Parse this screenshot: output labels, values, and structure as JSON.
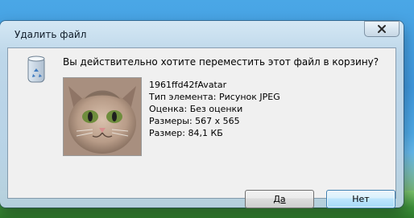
{
  "window": {
    "title": "Удалить файл"
  },
  "dialog": {
    "question": "Вы действительно хотите переместить этот файл в корзину?",
    "file": {
      "name": "1961ffd42fAvatar",
      "type": "Тип элемента: Рисунок JPEG",
      "rating": "Оценка: Без оценки",
      "dimensions": "Размеры: 567 x 565",
      "size": "Размер: 84,1 КБ"
    },
    "buttons": {
      "yes": "Да",
      "no": "Нет"
    }
  },
  "icons": {
    "close": "close-icon",
    "recycle_bin": "recycle-bin-icon",
    "thumbnail": "cat-avatar-thumbnail"
  }
}
